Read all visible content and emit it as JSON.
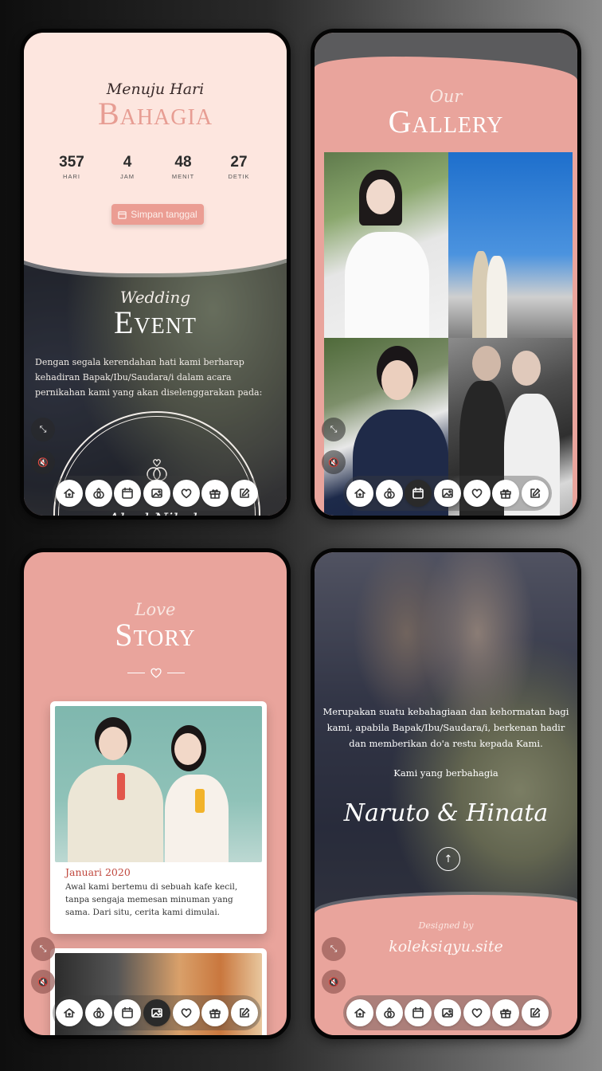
{
  "screen1": {
    "subtitle": "Menuju Hari",
    "title": "Bahagia",
    "countdown": [
      {
        "value": "357",
        "label": "HARI"
      },
      {
        "value": "4",
        "label": "JAM"
      },
      {
        "value": "48",
        "label": "MENIT"
      },
      {
        "value": "27",
        "label": "DETIK"
      }
    ],
    "save_button": "Simpan tanggal",
    "event_script": "Wedding",
    "event_title": "Event",
    "intro": "Dengan segala kerendahan hati kami berharap kehadiran Bapak/Ibu/Saudara/i dalam acara pernikahan kami yang akan diselenggarakan pada:",
    "event_name_partial": "Akad Nikah"
  },
  "screen2": {
    "script": "Our",
    "title": "Gallery"
  },
  "screen3": {
    "script": "Love",
    "title": "Story",
    "stories": [
      {
        "date": "Januari 2020",
        "text": "Awal kami bertemu di sebuah kafe kecil, tanpa sengaja memesan minuman yang sama. Dari situ, cerita kami dimulai."
      }
    ]
  },
  "screen4": {
    "message": "Merupakan suatu kebahagiaan dan kehormatan bagi kami, apabila Bapak/Ibu/Saudara/i, berkenan hadir dan memberikan do'a restu kepada Kami.",
    "signoff": "Kami yang berbahagia",
    "names": "Naruto & Hinata",
    "designed_by": "Designed by",
    "site": "koleksiqyu.site"
  },
  "nav_icons": [
    "home-icon",
    "rings-icon",
    "calendar-icon",
    "gallery-icon",
    "heart-icon",
    "gift-icon",
    "edit-icon"
  ],
  "active_nav": {
    "screen1": -1,
    "screen2": 2,
    "screen3": 3,
    "screen4": -1
  },
  "colors": {
    "accent": "#e9a49c",
    "blush": "#fde6df",
    "title_pink": "#e79d93",
    "date_red": "#c0483e"
  }
}
